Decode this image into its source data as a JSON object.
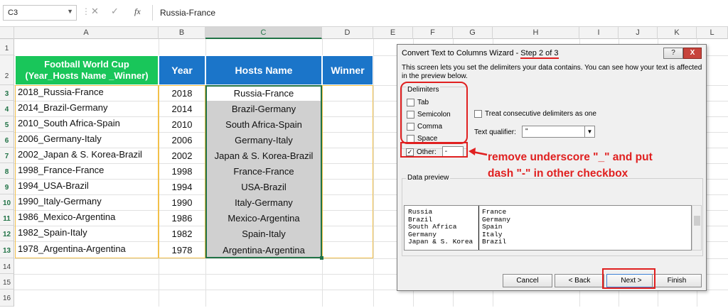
{
  "formula_bar": {
    "name_box": "C3",
    "fx": "fx",
    "content": "Russia-France"
  },
  "columns": [
    "A",
    "B",
    "C",
    "D",
    "E",
    "F",
    "G",
    "H",
    "I",
    "J",
    "K",
    "L"
  ],
  "rows": [
    "1",
    "2",
    "3",
    "4",
    "5",
    "6",
    "7",
    "8",
    "9",
    "10",
    "11",
    "12",
    "13",
    "14",
    "15",
    "16"
  ],
  "table": {
    "headers": {
      "a_line1": "Football World Cup",
      "a_line2": "(Year_Hosts Name _Winner)",
      "b": "Year",
      "c": "Hosts Name",
      "d": "Winner"
    },
    "rows": [
      {
        "a": "2018_Russia-France",
        "b": "2018",
        "c": "Russia-France"
      },
      {
        "a": "2014_Brazil-Germany",
        "b": "2014",
        "c": "Brazil-Germany"
      },
      {
        "a": "2010_South Africa-Spain",
        "b": "2010",
        "c": "South Africa-Spain"
      },
      {
        "a": "2006_Germany-Italy",
        "b": "2006",
        "c": "Germany-Italy"
      },
      {
        "a": "2002_Japan & S. Korea-Brazil",
        "b": "2002",
        "c": "Japan & S. Korea-Brazil"
      },
      {
        "a": "1998_France-France",
        "b": "1998",
        "c": "France-France"
      },
      {
        "a": "1994_USA-Brazil",
        "b": "1994",
        "c": "USA-Brazil"
      },
      {
        "a": "1990_Italy-Germany",
        "b": "1990",
        "c": "Italy-Germany"
      },
      {
        "a": "1986_Mexico-Argentina",
        "b": "1986",
        "c": "Mexico-Argentina"
      },
      {
        "a": "1982_Spain-Italy",
        "b": "1982",
        "c": "Spain-Italy"
      },
      {
        "a": "1978_Argentina-Argentina",
        "b": "1978",
        "c": "Argentina-Argentina"
      }
    ]
  },
  "dialog": {
    "title": "Convert Text to Columns Wizard - ",
    "step": "Step 2 of 3",
    "help": "?",
    "close": "X",
    "description": "This screen lets you set the delimiters your data contains.  You can see how your text is affected in the preview below.",
    "delimiters_label": "Delimiters",
    "tab": "Tab",
    "semicolon": "Semicolon",
    "comma": "Comma",
    "space": "Space",
    "other": "Other:",
    "other_value": "-",
    "consecutive": "Treat consecutive delimiters as one",
    "text_qualifier_label": "Text qualifier:",
    "text_qualifier_value": "\"",
    "preview_label": "Data preview",
    "preview_col1": [
      "Russia",
      "Brazil",
      "South Africa",
      "Germany",
      "Japan & S. Korea"
    ],
    "preview_col2": [
      "France",
      "Germany",
      "Spain",
      "Italy",
      "Brazil"
    ],
    "cancel": "Cancel",
    "back": "< Back",
    "next": "Next >",
    "finish": "Finish"
  },
  "annotation": {
    "line1": "remove underscore \"_\" and put",
    "line2": "dash \"-\" in other checkbox"
  },
  "colors": {
    "header_green": "#19c65a",
    "header_blue": "#1b75c9",
    "selected_fill": "#d0d0d0",
    "annotation_red": "#e02020",
    "border_yellow": "#f2c04a"
  }
}
